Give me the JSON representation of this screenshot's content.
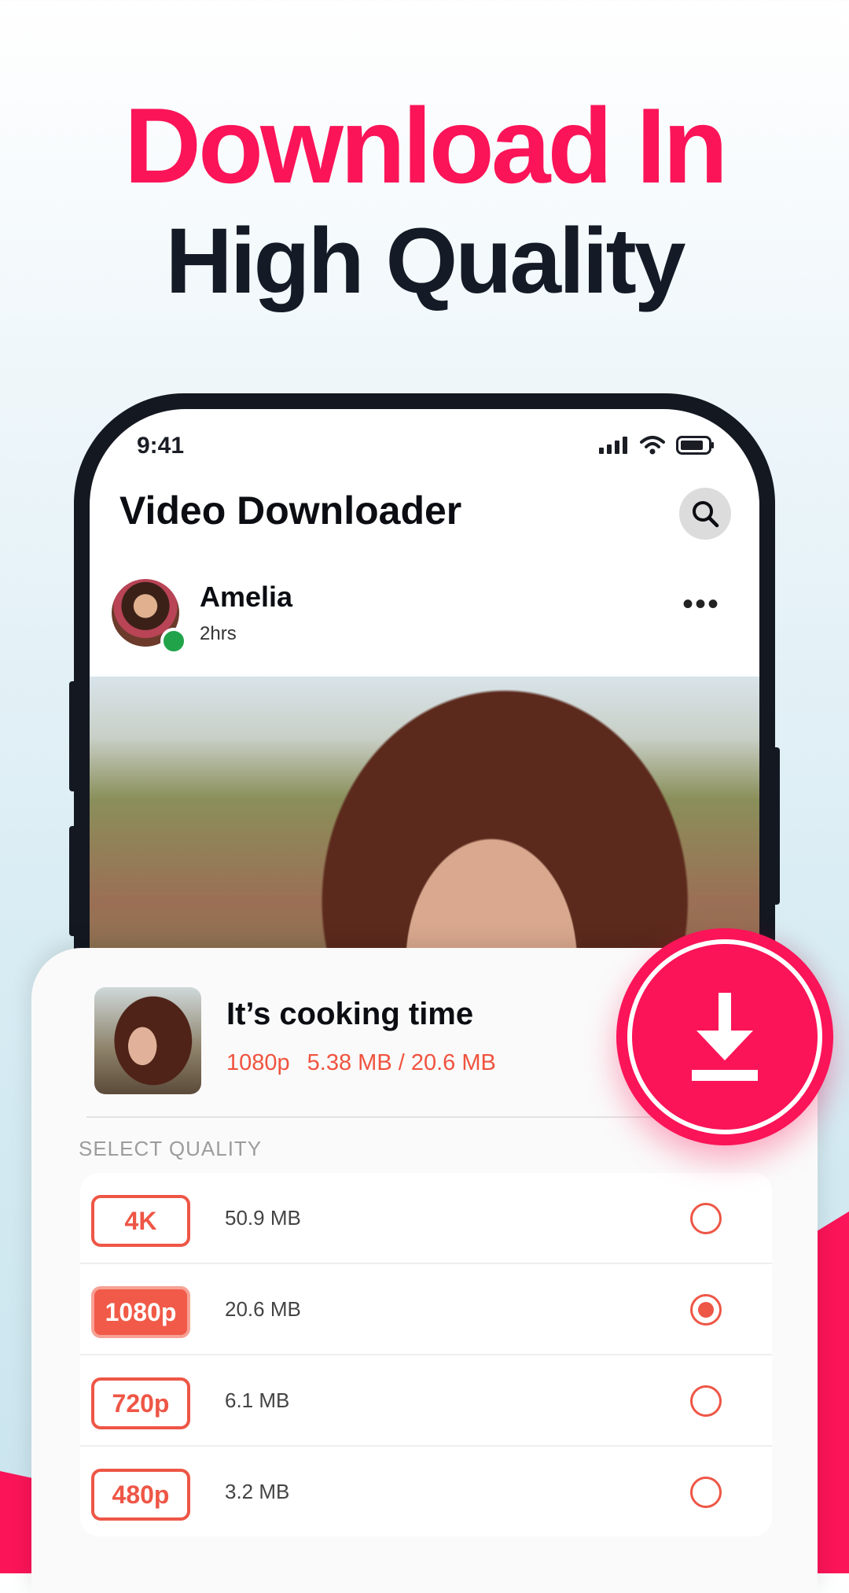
{
  "hero": {
    "line1": "Download In",
    "line2": "High Quality"
  },
  "status_bar": {
    "time": "9:41"
  },
  "app": {
    "title": "Video Downloader"
  },
  "post": {
    "user_name": "Amelia",
    "time_ago": "2hrs"
  },
  "download": {
    "title": "It’s cooking time",
    "resolution": "1080p",
    "progress_text": "5.38 MB / 20.6 MB",
    "progress_downloaded_mb": 5.38,
    "progress_total_mb": 20.6
  },
  "quality": {
    "label": "SELECT QUALITY",
    "options": [
      {
        "tag": "4K",
        "size": "50.9 MB",
        "selected": false
      },
      {
        "tag": "1080p",
        "size": "20.6 MB",
        "selected": true
      },
      {
        "tag": "720p",
        "size": "6.1 MB",
        "selected": false
      },
      {
        "tag": "480p",
        "size": "3.2 MB",
        "selected": false
      }
    ]
  },
  "colors": {
    "brand_pink": "#fb1458",
    "accent_orange_red": "#ee5646",
    "dark_text": "#151b26"
  },
  "icons": [
    "signal-icon",
    "wifi-icon",
    "battery-icon",
    "search-icon",
    "more-icon",
    "download-icon"
  ]
}
